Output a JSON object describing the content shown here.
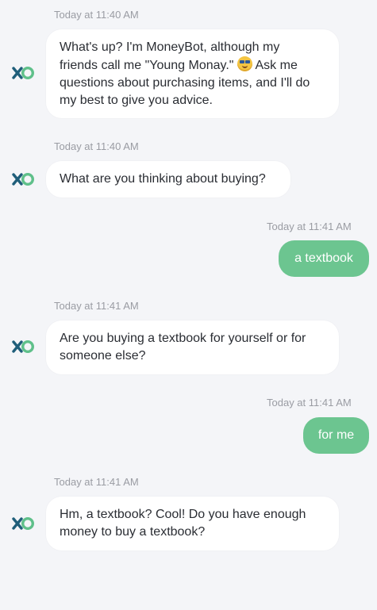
{
  "messages": [
    {
      "sender": "bot",
      "timestamp": "Today at 11:40 AM",
      "lines": [
        "What's up? I'm MoneyBot, although my",
        "friends call me \"Young Monay.\"",
        " Ask me",
        "questions about purchasing items, and I'll do",
        "my best to give you advice."
      ],
      "emoji": "smiling-face-with-sunglasses-emoji"
    },
    {
      "sender": "bot",
      "timestamp": "Today at 11:40 AM",
      "lines": [
        "What are you thinking about buying?"
      ]
    },
    {
      "sender": "user",
      "timestamp": "Today at 11:41 AM",
      "text": "a textbook"
    },
    {
      "sender": "bot",
      "timestamp": "Today at 11:41 AM",
      "lines": [
        "Are you buying a textbook for yourself or for",
        "someone else?"
      ]
    },
    {
      "sender": "user",
      "timestamp": "Today at 11:41 AM",
      "text": "for me"
    },
    {
      "sender": "bot",
      "timestamp": "Today at 11:41 AM",
      "lines": [
        "Hm, a textbook? Cool! Do you have enough",
        "money to buy a textbook?"
      ]
    }
  ],
  "colors": {
    "background": "#f4f5f8",
    "bot_bubble": "#ffffff",
    "user_bubble": "#6cc590",
    "avatar_dark": "#1f5e7a",
    "avatar_green": "#5fc08a",
    "timestamp": "#9a9ca3"
  },
  "avatar_icon": "moneybot-logo-icon"
}
